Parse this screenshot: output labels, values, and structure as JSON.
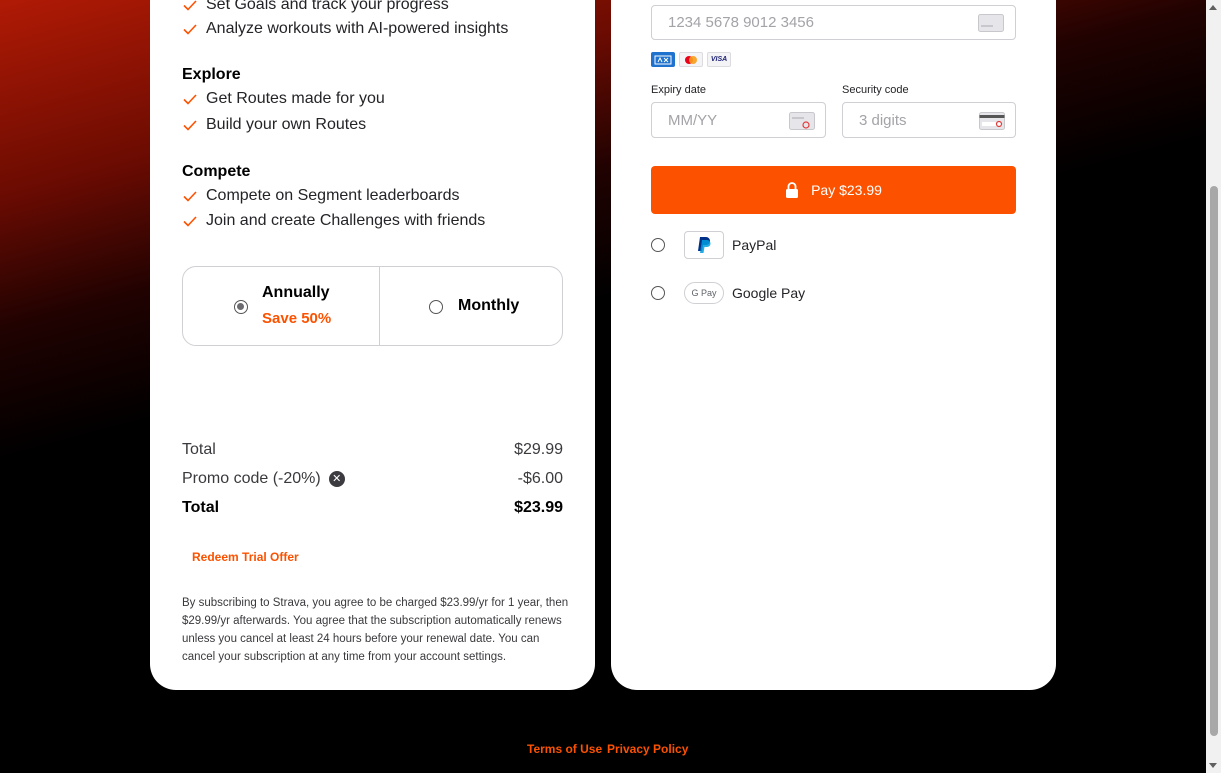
{
  "features": {
    "goals_line": "Set Goals and track your progress",
    "insights_line": "Analyze workouts with AI-powered insights",
    "explore_title": "Explore",
    "explore_items": [
      "Get Routes made for you",
      "Build your own Routes"
    ],
    "compete_title": "Compete",
    "compete_items": [
      "Compete on Segment leaderboards",
      "Join and create Challenges with friends"
    ]
  },
  "plans": {
    "annual_label": "Annually",
    "annual_save": "Save 50%",
    "monthly_label": "Monthly",
    "selected": "annual"
  },
  "summary": {
    "total_label": "Total",
    "total_value": "$29.99",
    "promo_label": "Promo code (-20%)",
    "promo_value": "-$6.00",
    "final_label": "Total",
    "final_value": "$23.99"
  },
  "redeem_label": "Redeem Trial Offer",
  "legal_text": "By subscribing to Strava, you agree to be charged $23.99/yr for 1 year, then $29.99/yr afterwards. You agree that the subscription automatically renews unless you cancel at least 24 hours before your renewal date. You can cancel your subscription at any time from your account settings.",
  "payment": {
    "card_number_placeholder": "1234 5678 9012 3456",
    "brands": [
      "AMEX",
      "Mastercard",
      "VISA"
    ],
    "expiry_label": "Expiry date",
    "expiry_placeholder": "MM/YY",
    "security_label": "Security code",
    "security_placeholder": "3 digits",
    "pay_label": "Pay $23.99",
    "paypal_label": "PayPal",
    "googlepay_label": "Google Pay",
    "googlepay_logo_text": "G Pay"
  },
  "footer": {
    "terms": "Terms of Use",
    "privacy": "Privacy Policy"
  },
  "colors": {
    "accent": "#fc5200",
    "background": "#000000",
    "card": "#ffffff"
  }
}
